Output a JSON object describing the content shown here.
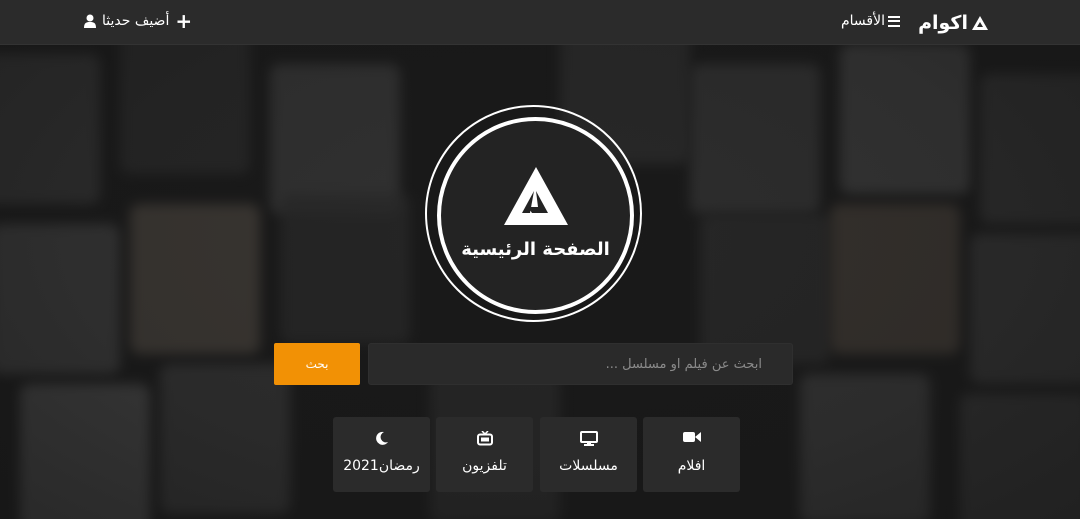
{
  "header": {
    "logo_text": "اكوام",
    "menu_label": "الأقسام",
    "recent_label": "أضيف حديثا",
    "icons": {
      "logo": "akwam-logo-icon",
      "menu": "hamburger-icon",
      "add": "plus-icon",
      "user": "user-icon"
    }
  },
  "hero": {
    "title": "الصفحة الرئيسية",
    "icon": "akwam-logo-icon"
  },
  "search": {
    "placeholder": "ابحث عن فيلم او مسلسل ...",
    "value": "",
    "button_label": "بحث"
  },
  "categories": [
    {
      "label": "افلام",
      "icon": "video-camera-icon"
    },
    {
      "label": "مسلسلات",
      "icon": "monitor-icon"
    },
    {
      "label": "تلفزيون",
      "icon": "tv-icon"
    },
    {
      "label": "رمضان2021",
      "icon": "moon-icon"
    }
  ],
  "colors": {
    "accent": "#f29105",
    "topbar": "#2b2b2b",
    "tile": "#2b2b2b",
    "text": "#ffffff"
  }
}
